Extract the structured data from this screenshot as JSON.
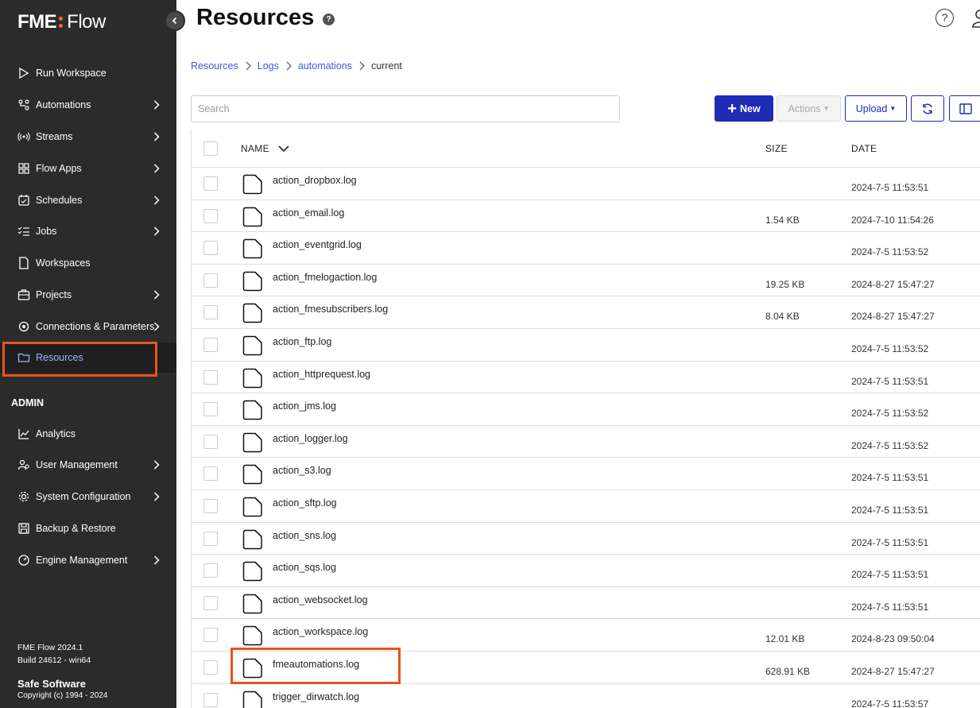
{
  "app": {
    "logo_left": "FME",
    "logo_right": "Flow"
  },
  "sidebar": {
    "items": [
      {
        "label": "Run Workspace",
        "icon": "play-icon",
        "chevron": false
      },
      {
        "label": "Automations",
        "icon": "automations-icon",
        "chevron": true
      },
      {
        "label": "Streams",
        "icon": "broadcast-icon",
        "chevron": true
      },
      {
        "label": "Flow Apps",
        "icon": "apps-grid-icon",
        "chevron": true
      },
      {
        "label": "Schedules",
        "icon": "calendar-icon",
        "chevron": true
      },
      {
        "label": "Jobs",
        "icon": "checklist-icon",
        "chevron": true
      },
      {
        "label": "Workspaces",
        "icon": "document-icon",
        "chevron": false
      },
      {
        "label": "Projects",
        "icon": "briefcase-icon",
        "chevron": true
      },
      {
        "label": "Connections & Parameters",
        "icon": "gear-link-icon",
        "chevron": true
      },
      {
        "label": "Resources",
        "icon": "folder-icon",
        "chevron": false,
        "active": true
      }
    ],
    "admin_label": "ADMIN",
    "admin_items": [
      {
        "label": "Analytics",
        "icon": "chart-line-icon",
        "chevron": false
      },
      {
        "label": "User Management",
        "icon": "users-icon",
        "chevron": true
      },
      {
        "label": "System Configuration",
        "icon": "gear-icon",
        "chevron": true
      },
      {
        "label": "Backup & Restore",
        "icon": "save-icon",
        "chevron": false
      },
      {
        "label": "Engine Management",
        "icon": "gauge-icon",
        "chevron": true
      }
    ],
    "footer": {
      "version": "FME Flow 2024.1",
      "build": "Build 24612 - win64",
      "company": "Safe Software",
      "copyright": "Copyright (c) 1994 - 2024"
    }
  },
  "header": {
    "title": "Resources",
    "help_glyph": "?"
  },
  "breadcrumb": {
    "items": [
      "Resources",
      "Logs",
      "automations"
    ],
    "current": "current"
  },
  "search": {
    "placeholder": "Search",
    "value": ""
  },
  "toolbar": {
    "new_label": "New",
    "actions_label": "Actions",
    "upload_label": "Upload"
  },
  "table": {
    "columns": {
      "name": "NAME",
      "size": "SIZE",
      "date": "DATE"
    },
    "rows": [
      {
        "name": "action_dropbox.log",
        "size": "",
        "date": "2024-7-5 11:53:51"
      },
      {
        "name": "action_email.log",
        "size": "1.54 KB",
        "date": "2024-7-10 11:54:26"
      },
      {
        "name": "action_eventgrid.log",
        "size": "",
        "date": "2024-7-5 11:53:52"
      },
      {
        "name": "action_fmelogaction.log",
        "size": "19.25 KB",
        "date": "2024-8-27 15:47:27"
      },
      {
        "name": "action_fmesubscribers.log",
        "size": "8.04 KB",
        "date": "2024-8-27 15:47:27"
      },
      {
        "name": "action_ftp.log",
        "size": "",
        "date": "2024-7-5 11:53:52"
      },
      {
        "name": "action_httprequest.log",
        "size": "",
        "date": "2024-7-5 11:53:51"
      },
      {
        "name": "action_jms.log",
        "size": "",
        "date": "2024-7-5 11:53:52"
      },
      {
        "name": "action_logger.log",
        "size": "",
        "date": "2024-7-5 11:53:52"
      },
      {
        "name": "action_s3.log",
        "size": "",
        "date": "2024-7-5 11:53:51"
      },
      {
        "name": "action_sftp.log",
        "size": "",
        "date": "2024-7-5 11:53:51"
      },
      {
        "name": "action_sns.log",
        "size": "",
        "date": "2024-7-5 11:53:51"
      },
      {
        "name": "action_sqs.log",
        "size": "",
        "date": "2024-7-5 11:53:51"
      },
      {
        "name": "action_websocket.log",
        "size": "",
        "date": "2024-7-5 11:53:51"
      },
      {
        "name": "action_workspace.log",
        "size": "12.01 KB",
        "date": "2024-8-23 09:50:04"
      },
      {
        "name": "fmeautomations.log",
        "size": "628.91 KB",
        "date": "2024-8-27 15:47:27"
      },
      {
        "name": "trigger_dirwatch.log",
        "size": "",
        "date": "2024-7-5 11:53:57"
      }
    ]
  },
  "colors": {
    "sidebar_bg": "#2b2b2b",
    "accent": "#1f2bb5",
    "link": "#3b5bdb",
    "highlight": "#e8541a",
    "logo_dot": "#f06a2a"
  }
}
